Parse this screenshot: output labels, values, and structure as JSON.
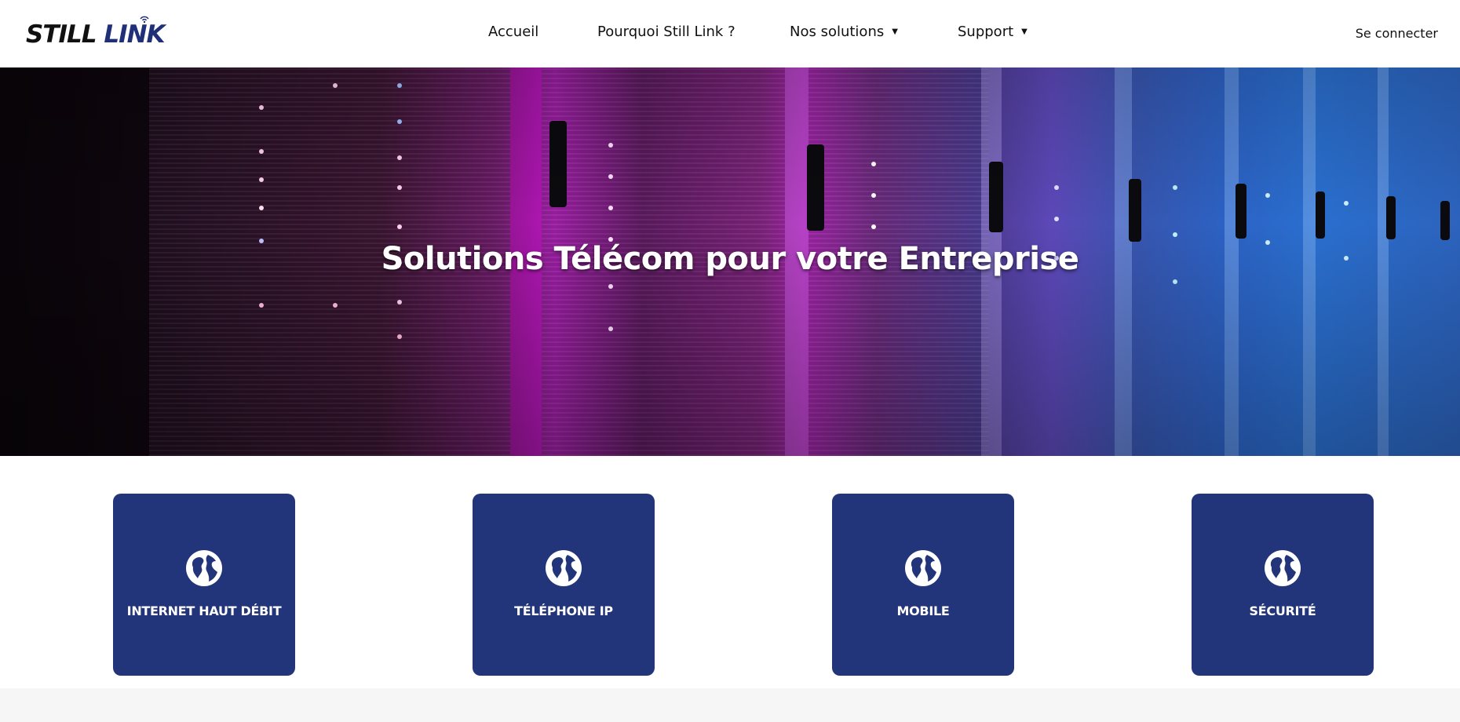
{
  "header": {
    "logo": {
      "part1": "STILL",
      "part2": "LINK"
    },
    "nav": [
      {
        "label": "Accueil",
        "has_dropdown": false
      },
      {
        "label": "Pourquoi Still Link ?",
        "has_dropdown": false
      },
      {
        "label": "Nos solutions",
        "has_dropdown": true
      },
      {
        "label": "Support",
        "has_dropdown": true
      }
    ],
    "caret": "▼",
    "login_label": "Se connecter"
  },
  "hero": {
    "title": "Solutions Télécom pour votre Entreprise"
  },
  "cards": [
    {
      "label": "INTERNET HAUT DÉBIT",
      "icon": "globe-icon"
    },
    {
      "label": "TÉLÉPHONE IP",
      "icon": "globe-icon"
    },
    {
      "label": "MOBILE",
      "icon": "globe-icon"
    },
    {
      "label": "SÉCURITÉ",
      "icon": "globe-icon"
    }
  ],
  "colors": {
    "brand_dark": "#1f2f78",
    "card_bg": "#22347a",
    "text": "#111111",
    "white": "#ffffff"
  }
}
